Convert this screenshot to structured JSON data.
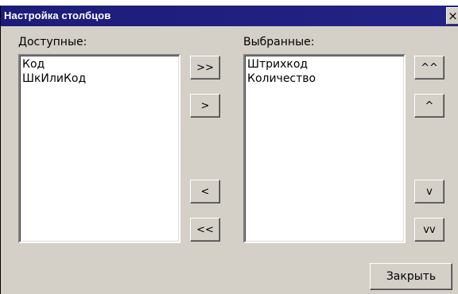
{
  "window": {
    "title": "Настройка столбцов",
    "close_glyph": "×"
  },
  "available": {
    "label": "Доступные:",
    "items": [
      "Код",
      "ШкИлиКод"
    ]
  },
  "selected": {
    "label": "Выбранные:",
    "items": [
      "Штрихкод",
      "Количество"
    ]
  },
  "transfer_buttons": {
    "add_all": ">>",
    "add_one": ">",
    "remove_one": "<",
    "remove_all": "<<"
  },
  "order_buttons": {
    "move_top": "^^",
    "move_up": "^",
    "move_down": "v",
    "move_bottom": "vv"
  },
  "footer": {
    "close_label": "Закрыть"
  }
}
